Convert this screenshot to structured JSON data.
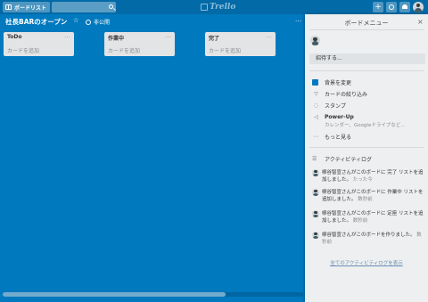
{
  "topbar": {
    "boards_label": "ボードリスト",
    "logo_text": "Trello",
    "plus": "+"
  },
  "board": {
    "title": "社長BARのオープン",
    "visibility": "非公開",
    "star": "☆",
    "more": "…"
  },
  "lists": [
    {
      "title": "ToDo",
      "add_card": "カードを追加",
      "menu": "…"
    },
    {
      "title": "作業中",
      "add_card": "カードを追加",
      "menu": "…"
    },
    {
      "title": "完了",
      "add_card": "カードを追加",
      "menu": "…"
    }
  ],
  "sidebar": {
    "title": "ボードメニュー",
    "close": "×",
    "invite": "招待する...",
    "menu": {
      "bg": "背景を変更",
      "filter": "カードの絞り込み",
      "stamp": "スタンプ",
      "powerup": "Power-Up",
      "powerup_sub": "カレンダー、Googleドライブなど...",
      "more": "もっと見る"
    },
    "activity_title": "アクティビティログ",
    "activities": [
      {
        "text": "柳谷智宣さんがこのボードに 完了 リストを追加しました。",
        "time": "たった今"
      },
      {
        "text": "柳谷智宣さんがこのボードに 作業中 リストを追加しました。",
        "time": "数秒前"
      },
      {
        "text": "柳谷智宣さんがこのボードに 定座 リストを追加しました。",
        "time": "数秒前"
      },
      {
        "text": "柳谷智宣さんがこのボードを作りました。",
        "time": "数秒前"
      }
    ],
    "all_activity": "全てのアクティビティログを表示"
  },
  "colors": {
    "board_bg": "#0079bf",
    "topbar": "#026aa7",
    "sidebar_bg": "#edeff0"
  }
}
